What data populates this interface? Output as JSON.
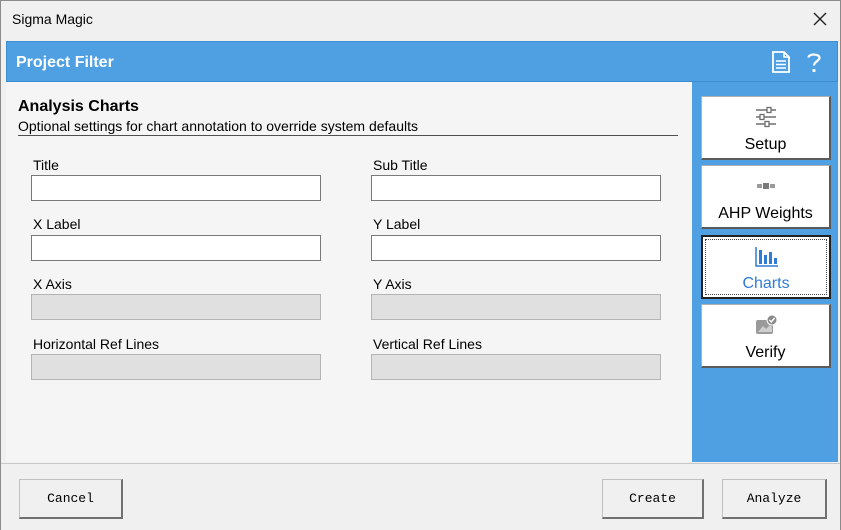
{
  "window": {
    "title": "Sigma Magic"
  },
  "header": {
    "title": "Project Filter"
  },
  "section": {
    "title": "Analysis Charts",
    "subtitle": "Optional settings for chart annotation to override system defaults"
  },
  "fields": {
    "title": {
      "label": "Title",
      "value": ""
    },
    "sub_title": {
      "label": "Sub Title",
      "value": ""
    },
    "x_label": {
      "label": "X Label",
      "value": ""
    },
    "y_label": {
      "label": "Y Label",
      "value": ""
    },
    "x_axis": {
      "label": "X Axis",
      "value": ""
    },
    "y_axis": {
      "label": "Y Axis",
      "value": ""
    },
    "h_ref": {
      "label": "Horizontal Ref Lines",
      "value": ""
    },
    "v_ref": {
      "label": "Vertical Ref Lines",
      "value": ""
    }
  },
  "nav": {
    "items": [
      {
        "label": "Setup",
        "icon": "sliders-icon",
        "active": false
      },
      {
        "label": "AHP Weights",
        "icon": "weights-icon",
        "active": false
      },
      {
        "label": "Charts",
        "icon": "bar-chart-icon",
        "active": true
      },
      {
        "label": "Verify",
        "icon": "verify-icon",
        "active": false
      }
    ]
  },
  "buttons": {
    "cancel": "Cancel",
    "create": "Create",
    "analyze": "Analyze"
  },
  "colors": {
    "header": "#4ea0e3",
    "sidebar": "#4ea0e3",
    "active_label": "#2f7bd6"
  }
}
